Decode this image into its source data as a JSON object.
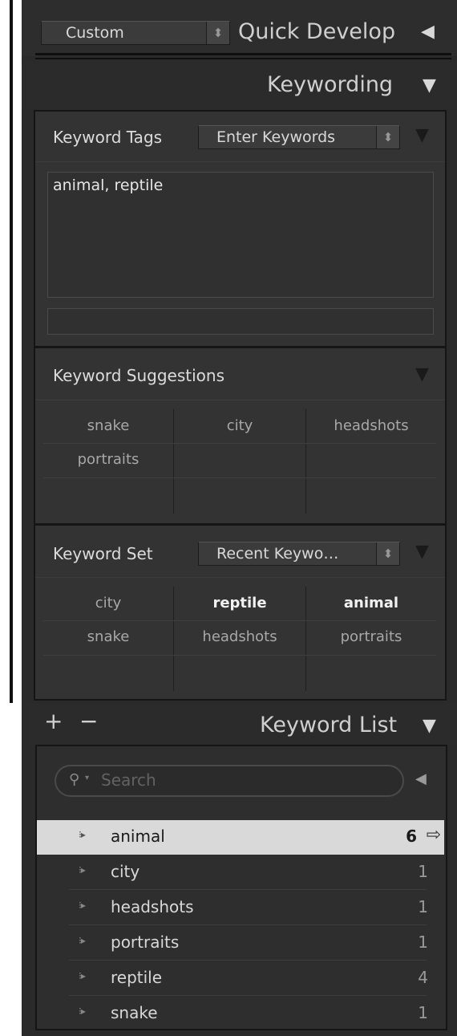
{
  "quick_develop": {
    "preset_value": "Custom",
    "title": "Quick Develop",
    "toggle_glyph": "◀"
  },
  "keywording": {
    "title": "Keywording",
    "toggle_glyph": "▼",
    "keyword_tags": {
      "label": "Keyword Tags",
      "mode_value": "Enter Keywords",
      "text": "animal, reptile",
      "new_keyword_value": ""
    },
    "keyword_suggestions": {
      "label": "Keyword Suggestions",
      "rows": [
        [
          "snake",
          "city",
          "headshots"
        ],
        [
          "portraits",
          "",
          ""
        ],
        [
          "",
          "",
          ""
        ]
      ]
    },
    "keyword_set": {
      "label": "Keyword Set",
      "set_value": "Recent Keywo…",
      "rows": [
        [
          "city",
          "reptile",
          "animal"
        ],
        [
          "snake",
          "headshots",
          "portraits"
        ],
        [
          "",
          "",
          ""
        ]
      ],
      "applied": [
        "reptile",
        "animal"
      ]
    }
  },
  "keyword_list": {
    "title": "Keyword List",
    "add_glyph": "+",
    "remove_glyph": "−",
    "toggle_glyph": "▼",
    "search_placeholder": "Search",
    "items": [
      {
        "name": "animal",
        "count": "6",
        "selected": true
      },
      {
        "name": "city",
        "count": "1",
        "selected": false
      },
      {
        "name": "headshots",
        "count": "1",
        "selected": false
      },
      {
        "name": "portraits",
        "count": "1",
        "selected": false
      },
      {
        "name": "reptile",
        "count": "4",
        "selected": false
      },
      {
        "name": "snake",
        "count": "1",
        "selected": false
      }
    ]
  },
  "icons": {
    "search_icon": "magnifier",
    "stepper_icon": "updown",
    "filter_arrow_icon": "triangle-left",
    "row_arrow_icon": "dotted-triangle",
    "goto_icon": "arrow-right-outline"
  },
  "colors": {
    "panel_bg": "#2a2a2a",
    "section_bg": "#333333",
    "selected_row_bg": "#d9d9d9"
  }
}
